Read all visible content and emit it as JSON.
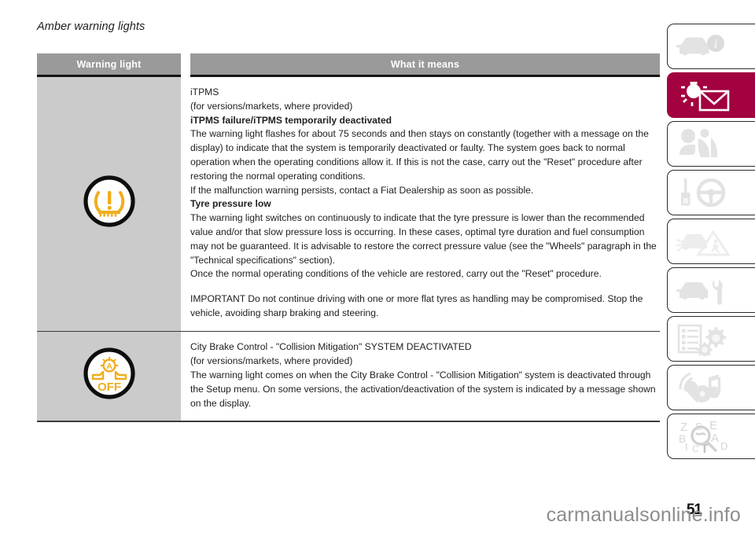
{
  "page": {
    "heading": "Amber warning lights",
    "number": "51",
    "watermark": "carmanualsonline.info"
  },
  "table": {
    "columns": {
      "warning_light": "Warning light",
      "what_it_means": "What it means"
    },
    "rows": [
      {
        "icon_name": "tpms-warning-light-icon",
        "icon_label": "Tyre pressure monitoring system warning light",
        "paragraphs": [
          {
            "text": "iTPMS",
            "bold": false
          },
          {
            "text": "(for versions/markets, where provided)",
            "bold": false
          },
          {
            "text": "iTPMS failure/iTPMS temporarily deactivated",
            "bold": true
          },
          {
            "text": "The warning light flashes for about 75 seconds and then stays on constantly (together with a message on the display) to indicate that the system is temporarily deactivated or faulty. The system goes back to normal operation when the operating conditions allow it. If this is not the case, carry out the \"Reset\" procedure after restoring the normal operating conditions.",
            "bold": false
          },
          {
            "text": "If the malfunction warning persists, contact a Fiat Dealership as soon as possible.",
            "bold": false
          },
          {
            "text": "Tyre pressure low",
            "bold": true
          },
          {
            "text": "The warning light switches on continuously to indicate that the tyre pressure is lower than the recommended value and/or that slow pressure loss is occurring. In these cases, optimal tyre duration and fuel consumption may not be guaranteed. It is advisable to restore the correct pressure value (see the \"Wheels\" paragraph in the \"Technical specifications\" section).",
            "bold": false
          },
          {
            "text": "Once the normal operating conditions of the vehicle are restored, carry out the \"Reset\" procedure.",
            "bold": false
          },
          {
            "text": "",
            "bold": false,
            "spacer": true
          },
          {
            "text": "IMPORTANT Do not continue driving with one or more flat tyres as handling may be compromised. Stop the vehicle, avoiding sharp braking and steering.",
            "bold": false
          }
        ]
      },
      {
        "icon_name": "city-brake-control-off-icon",
        "icon_label": "City Brake Control OFF warning light",
        "icon_text": "OFF",
        "paragraphs": [
          {
            "text": "City Brake Control - \"Collision Mitigation\" SYSTEM DEACTIVATED",
            "bold": false
          },
          {
            "text": "(for versions/markets, where provided)",
            "bold": false
          },
          {
            "text": "The warning light comes on when the City Brake Control - \"Collision Mitigation\" system is deactivated through the Setup menu. On some versions, the activation/deactivation of the system is indicated by a message shown on the display.",
            "bold": false
          }
        ]
      }
    ]
  },
  "tab_rail": {
    "active_color": "#a2023f",
    "inactive_icon_color": "#e3e3e3",
    "tabs": [
      {
        "name": "tab-dashboard-info",
        "icon": "car-info-icon",
        "active": false
      },
      {
        "name": "tab-warning-lights-messages",
        "icon": "warning-light-message-icon",
        "active": true
      },
      {
        "name": "tab-safety",
        "icon": "airbag-seatbelt-icon",
        "active": false
      },
      {
        "name": "tab-starting-and-driving",
        "icon": "key-steering-wheel-icon",
        "active": false
      },
      {
        "name": "tab-in-emergency",
        "icon": "breakdown-hazard-icon",
        "active": false
      },
      {
        "name": "tab-maintenance-and-care",
        "icon": "car-wrench-icon",
        "active": false
      },
      {
        "name": "tab-technical-specifications",
        "icon": "spec-list-gears-icon",
        "active": false
      },
      {
        "name": "tab-multimedia",
        "icon": "radio-music-icon",
        "active": false
      },
      {
        "name": "tab-alphabetical-index",
        "icon": "alphabetical-index-icon",
        "active": false
      }
    ]
  },
  "colors": {
    "header_gray": "#9a9a9a",
    "row_gray": "#cbcbcb",
    "amber": "#f0ad1d",
    "rule_dark": "#3b3b3b"
  }
}
